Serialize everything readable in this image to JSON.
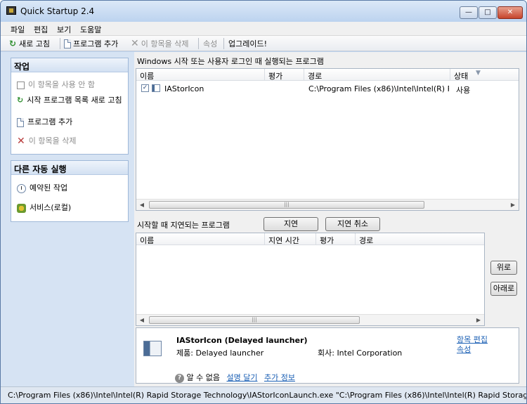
{
  "window": {
    "title": "Quick Startup 2.4"
  },
  "menu": [
    "파일",
    "편집",
    "보기",
    "도움말"
  ],
  "toolbar": {
    "refresh": "새로 고침",
    "add_program": "프로그램 추가",
    "delete_item": "이 항목을 삭제",
    "properties": "속성",
    "upgrade": "업그레이드!"
  },
  "tasks": {
    "title": "작업",
    "disable_item": "이 항목을 사용 안 함",
    "refresh_list": "시작 프로그램 목록 새로 고침",
    "add_program": "프로그램 추가",
    "delete_item": "이 항목을 삭제"
  },
  "autorun": {
    "title": "다른 자동 실행",
    "scheduled": "예약된 작업",
    "services": "서비스(로컬)"
  },
  "startup": {
    "label": "Windows 시작 또는 사용자 로그인 때 실행되는 프로그램",
    "columns": [
      "이름",
      "평가",
      "경로",
      "상태"
    ],
    "rows": [
      {
        "checked": true,
        "name": "IAStorIcon",
        "rating": "",
        "path": "C:\\Program Files (x86)\\Intel\\Intel(R) Rap",
        "status": "사용"
      }
    ]
  },
  "delayed": {
    "label": "시작할 때 지연되는 프로그램",
    "delay_button": "지연",
    "undelay_button": "지연 취소",
    "columns": [
      "이름",
      "지연 시간",
      "평가",
      "경로"
    ],
    "up_button": "위로",
    "down_button": "아래로"
  },
  "info": {
    "title": "IAStorIcon (Delayed launcher)",
    "product_label": "제품: Delayed launcher",
    "company_label": "회사: Intel Corporation",
    "edit_link": "항목 편집",
    "properties_link": "속성",
    "unknown": "알 수 없음",
    "comment_link": "설명 달기",
    "more_link": "추가 정보"
  },
  "status": {
    "path": "C:\\Program Files (x86)\\Intel\\Intel(R) Rapid Storage Technology\\IAStorIconLaunch.exe \"C:\\Program Files (x86)\\Intel\\Intel(R) Rapid Storage Technology\\"
  }
}
